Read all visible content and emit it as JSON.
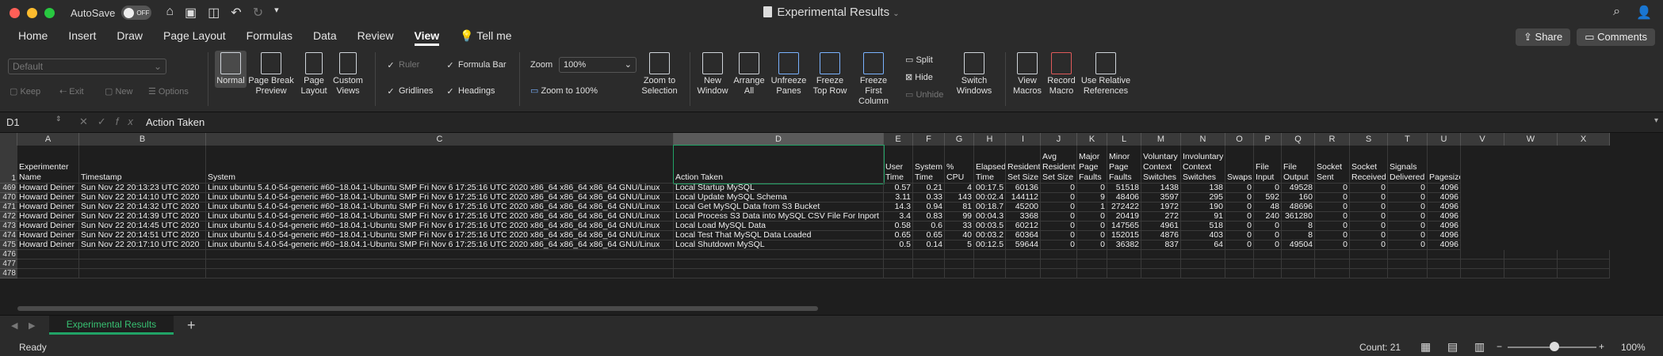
{
  "window": {
    "title": "Experimental Results",
    "autosave_label": "AutoSave",
    "autosave_state": "OFF"
  },
  "ribbon_tabs": [
    "Home",
    "Insert",
    "Draw",
    "Page Layout",
    "Formulas",
    "Data",
    "Review",
    "View"
  ],
  "active_tab": "View",
  "tell_me": "Tell me",
  "share_label": "Share",
  "comments_label": "Comments",
  "ribbon": {
    "sheet_view_select": "Default",
    "keep": "Keep",
    "exit": "Exit",
    "new": "New",
    "options": "Options",
    "normal": "Normal",
    "page_break_preview": "Page Break Preview",
    "page_layout": "Page Layout",
    "custom_views": "Custom Views",
    "ruler": "Ruler",
    "gridlines": "Gridlines",
    "formula_bar": "Formula Bar",
    "headings": "Headings",
    "zoom_label": "Zoom",
    "zoom_value": "100%",
    "zoom_to_100": "Zoom to 100%",
    "zoom_to_selection": "Zoom to Selection",
    "new_window": "New Window",
    "arrange_all": "Arrange All",
    "unfreeze_panes": "Unfreeze Panes",
    "freeze_top_row": "Freeze Top Row",
    "freeze_first_column": "Freeze First Column",
    "split": "Split",
    "hide": "Hide",
    "unhide": "Unhide",
    "switch_windows": "Switch Windows",
    "view_macros": "View Macros",
    "record_macro": "Record Macro",
    "use_relative_references": "Use Relative References"
  },
  "formula_bar": {
    "name_box": "D1",
    "fx": "fx",
    "content": "Action Taken"
  },
  "columns": [
    "A",
    "B",
    "C",
    "D",
    "E",
    "F",
    "G",
    "H",
    "I",
    "J",
    "K",
    "L",
    "M",
    "N",
    "O",
    "P",
    "Q",
    "R",
    "S",
    "T",
    "U",
    "V",
    "W",
    "X"
  ],
  "header_row": {
    "row_number": "1",
    "cells": [
      "Experimenter Name",
      "Timestamp",
      "System",
      "Action Taken",
      "User Time",
      "System Time",
      "% CPU",
      "Elapsed Time",
      "Resident Set Size",
      "Avg Resident Set Size",
      "Major Page Faults",
      "Minor Page Faults",
      "Voluntary Context Switches",
      "Involuntary Context Switches",
      "Swaps",
      "File Input",
      "File Output",
      "Socket Sent",
      "Socket Received",
      "Signals Delivered",
      "Pagesize"
    ]
  },
  "rows": [
    {
      "n": "469",
      "cells": [
        "Howard Deiner",
        "Sun Nov 22 20:13:23 UTC 2020",
        "Linux ubuntu 5.4.0-54-generic #60~18.04.1-Ubuntu SMP Fri Nov 6 17:25:16 UTC 2020 x86_64 x86_64 x86_64 GNU/Linux",
        "Local Startup MySQL",
        "0.57",
        "0.21",
        "4",
        "00:17.5",
        "60136",
        "0",
        "0",
        "51518",
        "1438",
        "138",
        "0",
        "0",
        "49528",
        "0",
        "0",
        "0",
        "4096"
      ]
    },
    {
      "n": "470",
      "cells": [
        "Howard Deiner",
        "Sun Nov 22 20:14:10 UTC 2020",
        "Linux ubuntu 5.4.0-54-generic #60~18.04.1-Ubuntu SMP Fri Nov 6 17:25:16 UTC 2020 x86_64 x86_64 x86_64 GNU/Linux",
        "Local Update MySQL Schema",
        "3.11",
        "0.33",
        "143",
        "00:02.4",
        "144112",
        "0",
        "9",
        "48406",
        "3597",
        "295",
        "0",
        "592",
        "160",
        "0",
        "0",
        "0",
        "4096"
      ]
    },
    {
      "n": "471",
      "cells": [
        "Howard Deiner",
        "Sun Nov 22 20:14:32 UTC 2020",
        "Linux ubuntu 5.4.0-54-generic #60~18.04.1-Ubuntu SMP Fri Nov 6 17:25:16 UTC 2020 x86_64 x86_64 x86_64 GNU/Linux",
        "Local Get MySQL Data from S3 Bucket",
        "14.3",
        "0.94",
        "81",
        "00:18.7",
        "45200",
        "0",
        "1",
        "272422",
        "1972",
        "190",
        "0",
        "48",
        "48696",
        "0",
        "0",
        "0",
        "4096"
      ]
    },
    {
      "n": "472",
      "cells": [
        "Howard Deiner",
        "Sun Nov 22 20:14:39 UTC 2020",
        "Linux ubuntu 5.4.0-54-generic #60~18.04.1-Ubuntu SMP Fri Nov 6 17:25:16 UTC 2020 x86_64 x86_64 x86_64 GNU/Linux",
        "Local Process S3 Data into MySQL CSV File For Inport",
        "3.4",
        "0.83",
        "99",
        "00:04.3",
        "3368",
        "0",
        "0",
        "20419",
        "272",
        "91",
        "0",
        "240",
        "361280",
        "0",
        "0",
        "0",
        "4096"
      ]
    },
    {
      "n": "473",
      "cells": [
        "Howard Deiner",
        "Sun Nov 22 20:14:45 UTC 2020",
        "Linux ubuntu 5.4.0-54-generic #60~18.04.1-Ubuntu SMP Fri Nov 6 17:25:16 UTC 2020 x86_64 x86_64 x86_64 GNU/Linux",
        "Local Load MySQL Data",
        "0.58",
        "0.6",
        "33",
        "00:03.5",
        "60212",
        "0",
        "0",
        "147565",
        "4961",
        "518",
        "0",
        "0",
        "8",
        "0",
        "0",
        "0",
        "4096"
      ]
    },
    {
      "n": "474",
      "cells": [
        "Howard Deiner",
        "Sun Nov 22 20:14:51 UTC 2020",
        "Linux ubuntu 5.4.0-54-generic #60~18.04.1-Ubuntu SMP Fri Nov 6 17:25:16 UTC 2020 x86_64 x86_64 x86_64 GNU/Linux",
        "Local Test That MySQL Data Loaded",
        "0.65",
        "0.65",
        "40",
        "00:03.2",
        "60364",
        "0",
        "0",
        "152015",
        "4876",
        "403",
        "0",
        "0",
        "8",
        "0",
        "0",
        "0",
        "4096"
      ]
    },
    {
      "n": "475",
      "cells": [
        "Howard Deiner",
        "Sun Nov 22 20:17:10 UTC 2020",
        "Linux ubuntu 5.4.0-54-generic #60~18.04.1-Ubuntu SMP Fri Nov 6 17:25:16 UTC 2020 x86_64 x86_64 x86_64 GNU/Linux",
        "Local Shutdown MySQL",
        "0.5",
        "0.14",
        "5",
        "00:12.5",
        "59644",
        "0",
        "0",
        "36382",
        "837",
        "64",
        "0",
        "0",
        "49504",
        "0",
        "0",
        "0",
        "4096"
      ]
    }
  ],
  "empty_rows": [
    "476",
    "477",
    "478"
  ],
  "sheet_tab": "Experimental Results",
  "status": {
    "ready": "Ready",
    "count": "Count: 21",
    "zoom": "100%"
  }
}
